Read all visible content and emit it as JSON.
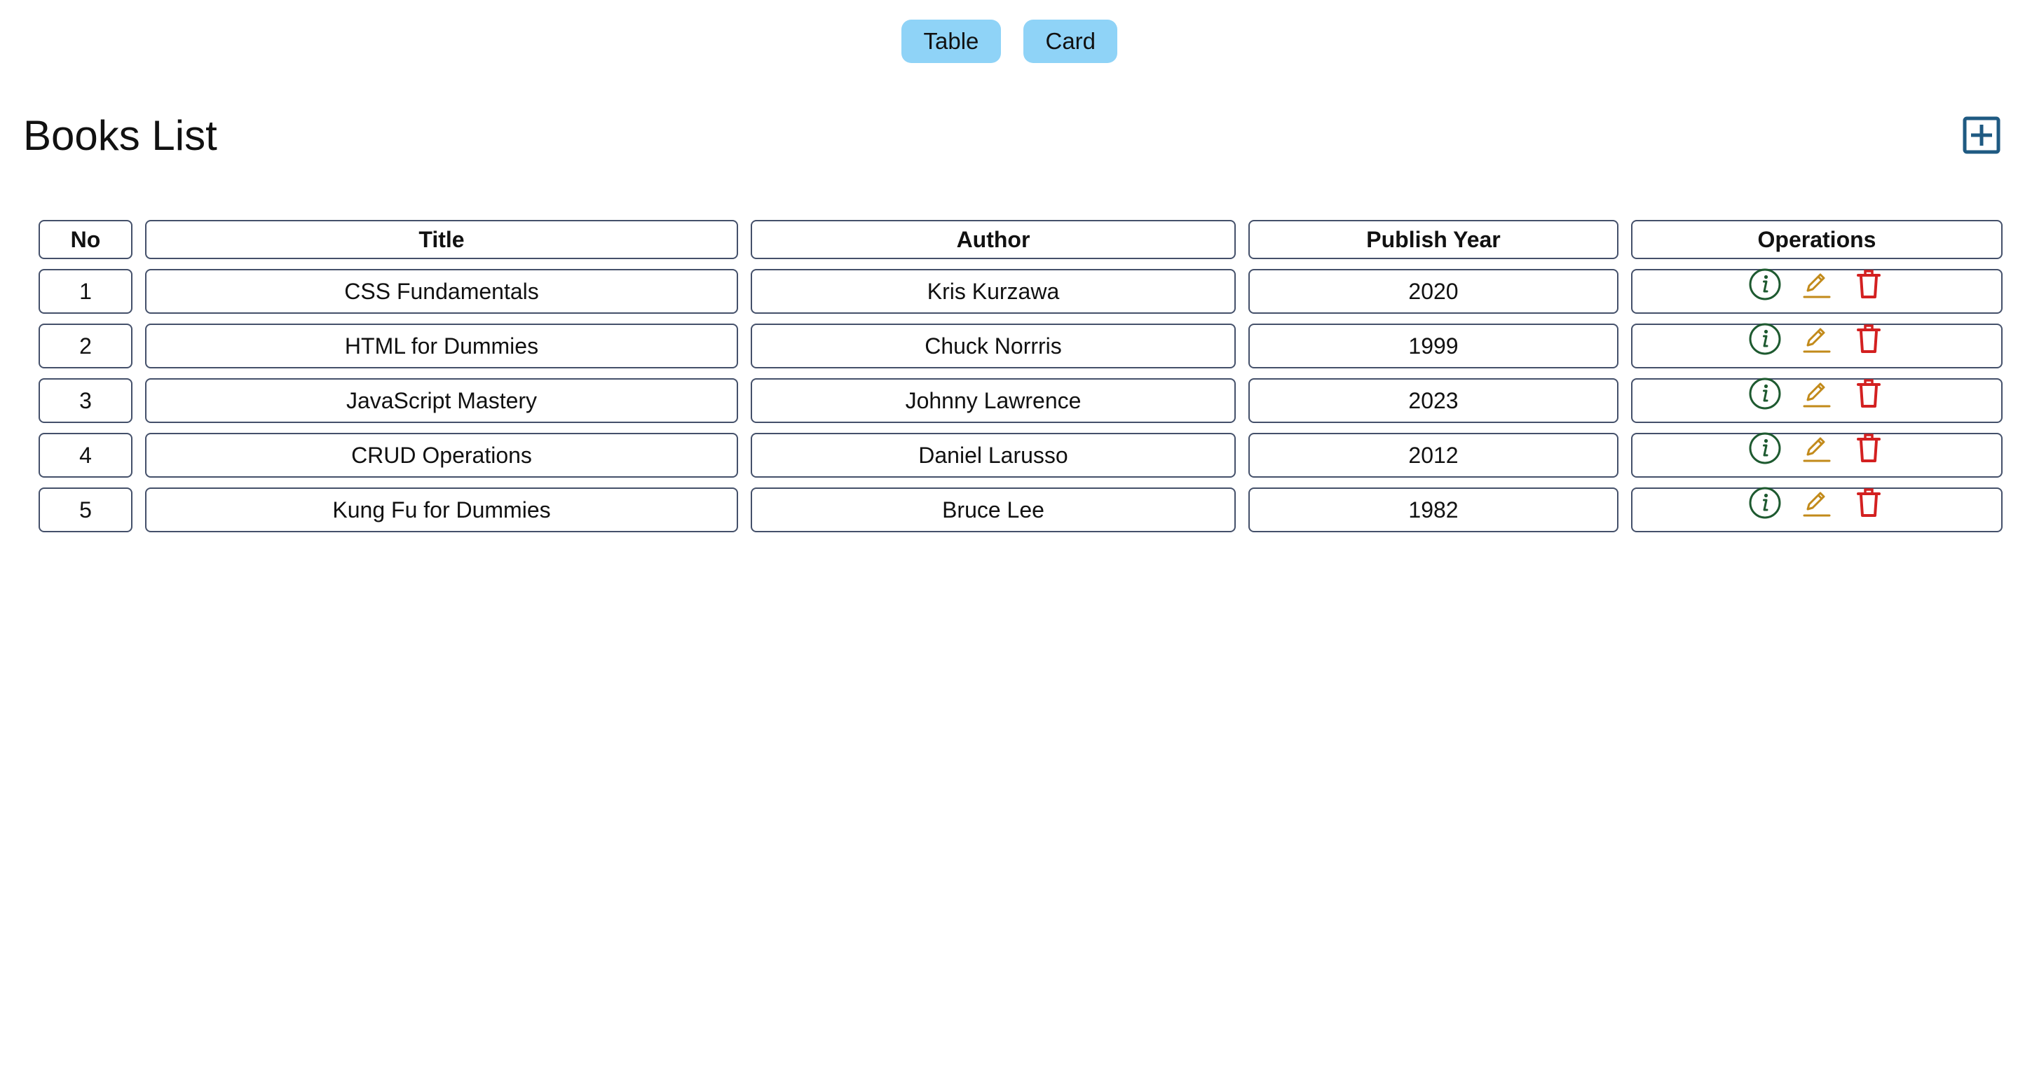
{
  "view_toggle": {
    "table_label": "Table",
    "card_label": "Card"
  },
  "header": {
    "title": "Books List",
    "add_icon": "plus-square-icon"
  },
  "table": {
    "columns": [
      "No",
      "Title",
      "Author",
      "Publish Year",
      "Operations"
    ],
    "rows": [
      {
        "no": "1",
        "title": "CSS Fundamentals",
        "author": "Kris Kurzawa",
        "year": "2020"
      },
      {
        "no": "2",
        "title": "HTML for Dummies",
        "author": "Chuck Norrris",
        "year": "1999"
      },
      {
        "no": "3",
        "title": "JavaScript Mastery",
        "author": "Johnny Lawrence",
        "year": "2023"
      },
      {
        "no": "4",
        "title": "CRUD Operations",
        "author": "Daniel Larusso",
        "year": "2012"
      },
      {
        "no": "5",
        "title": "Kung Fu for Dummies",
        "author": "Bruce Lee",
        "year": "1982"
      }
    ],
    "operation_icons": [
      "info-circle-icon",
      "edit-pencil-icon",
      "trash-icon"
    ]
  },
  "colors": {
    "toggle_bg": "#8fd3f7",
    "add_icon": "#1f5a82",
    "cell_border": "#44506a",
    "info_icon": "#1e5a30",
    "edit_icon": "#c28a1a",
    "delete_icon": "#d32020"
  }
}
